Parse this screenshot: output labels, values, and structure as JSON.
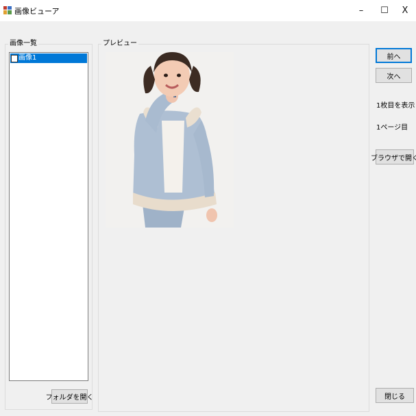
{
  "window": {
    "title": "画像ビューア",
    "minimize_icon": "minimize-icon",
    "maximize_icon": "maximize-icon",
    "close_icon": "close-icon",
    "minimize_glyph": "–",
    "maximize_glyph": "☐",
    "close_glyph": "X"
  },
  "image_list": {
    "group_label": "画像一覧",
    "items": [
      {
        "label": "画像1",
        "checked": false,
        "selected": true
      }
    ],
    "open_folder_label": "フォルダを開く"
  },
  "preview": {
    "group_label": "プレビュー"
  },
  "controls": {
    "prev_label": "前へ",
    "next_label": "次へ",
    "image_index_text": "1枚目を表示",
    "page_text": "1ページ目",
    "open_browser_label": "ブラウザで開く",
    "close_label": "閉じる"
  },
  "colors": {
    "selection": "#0078d7",
    "window_bg": "#f0f0f0",
    "titlebar_bg": "#ffffff"
  }
}
